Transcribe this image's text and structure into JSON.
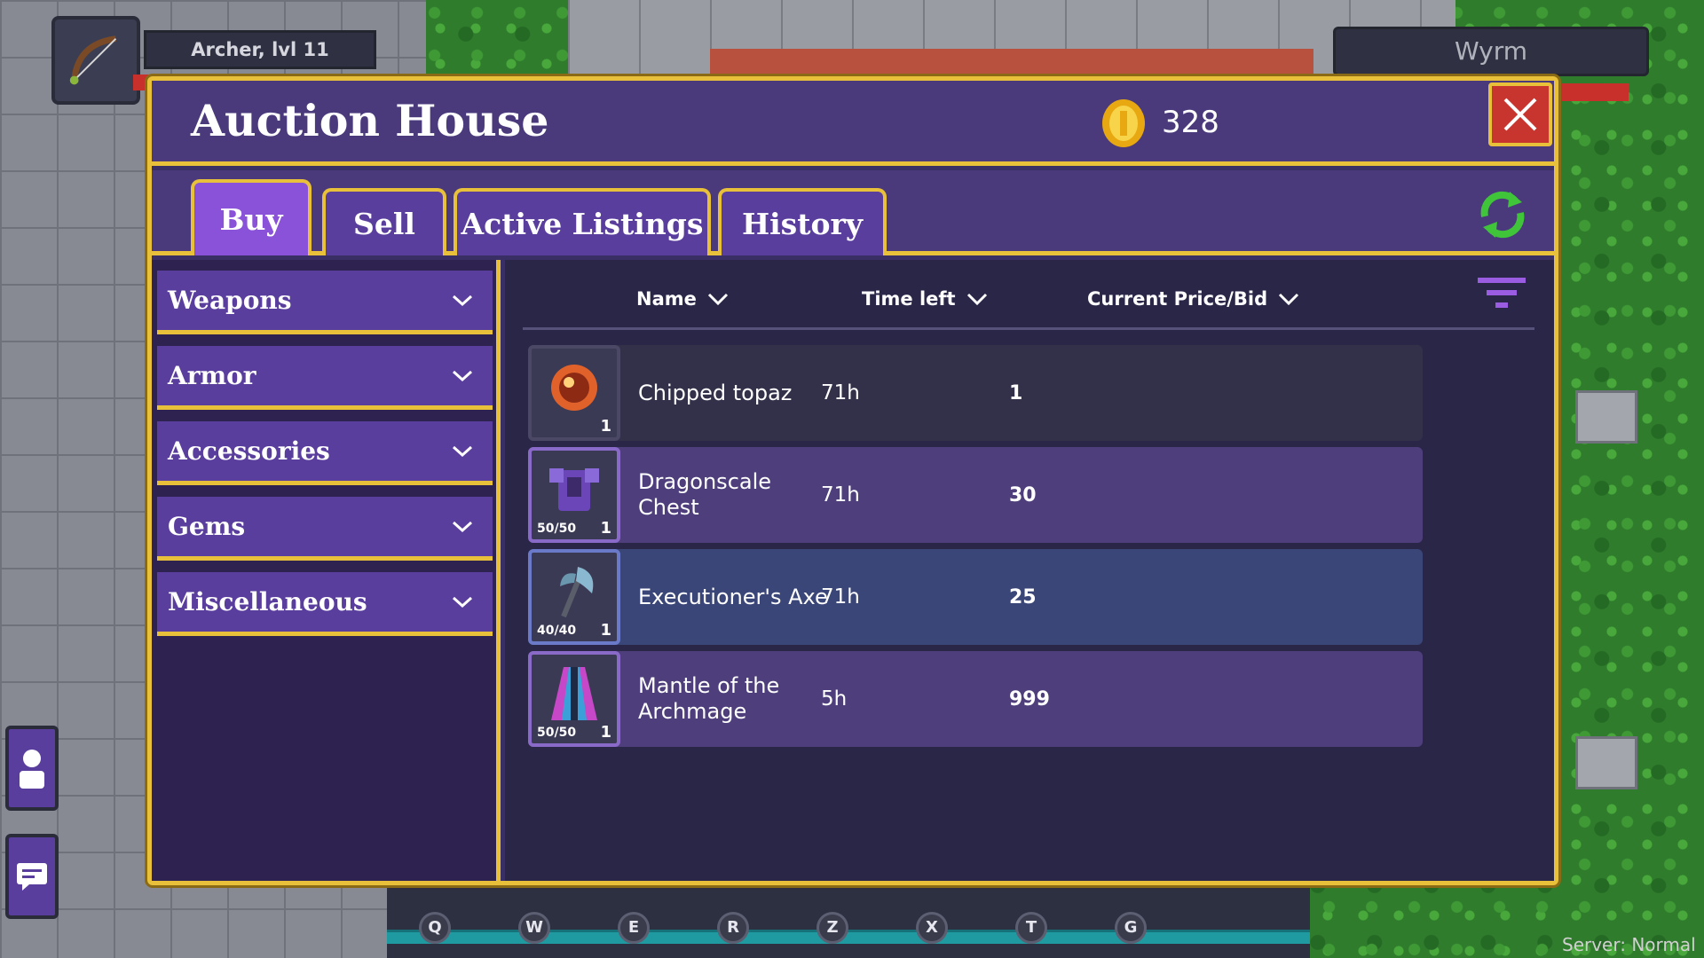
{
  "player": {
    "name_level": "Archer, lvl 11"
  },
  "target": {
    "name": "Wyrm"
  },
  "auction": {
    "title": "Auction House",
    "gold": "328",
    "tabs": [
      {
        "label": "Buy",
        "active": true
      },
      {
        "label": "Sell",
        "active": false
      },
      {
        "label": "Active Listings",
        "active": false
      },
      {
        "label": "History",
        "active": false
      }
    ],
    "categories": [
      {
        "label": "Weapons"
      },
      {
        "label": "Armor"
      },
      {
        "label": "Accessories"
      },
      {
        "label": "Gems"
      },
      {
        "label": "Miscellaneous"
      }
    ],
    "columns": {
      "name": "Name",
      "time_left": "Time left",
      "price": "Current Price/Bid"
    },
    "listings": [
      {
        "name": "Chipped topaz",
        "time_left": "71h",
        "price": "1",
        "quantity": "1",
        "durability": "",
        "icon": "topaz-gem-icon"
      },
      {
        "name": "Dragonscale Chest",
        "time_left": "71h",
        "price": "30",
        "quantity": "1",
        "durability": "50/50",
        "icon": "chest-armor-icon"
      },
      {
        "name": "Executioner's Axe",
        "time_left": "71h",
        "price": "25",
        "quantity": "1",
        "durability": "40/40",
        "icon": "axe-icon"
      },
      {
        "name": "Mantle of the Archmage",
        "time_left": "5h",
        "price": "999",
        "quantity": "1",
        "durability": "50/50",
        "icon": "mantle-icon"
      }
    ]
  },
  "hotbar": {
    "keys": [
      "Q",
      "W",
      "E",
      "R",
      "Z",
      "X",
      "T",
      "G"
    ]
  },
  "server": {
    "label": "Server: Normal"
  },
  "colors": {
    "panel": "#3a2f64",
    "accent_border": "#e8c03a",
    "tab_active": "#8a52d8",
    "tab": "#5a3e9e",
    "close_button": "#c8342e",
    "row_dark": "#33314a",
    "row_purple": "#4e3f7c",
    "row_blue": "#3b4678"
  }
}
